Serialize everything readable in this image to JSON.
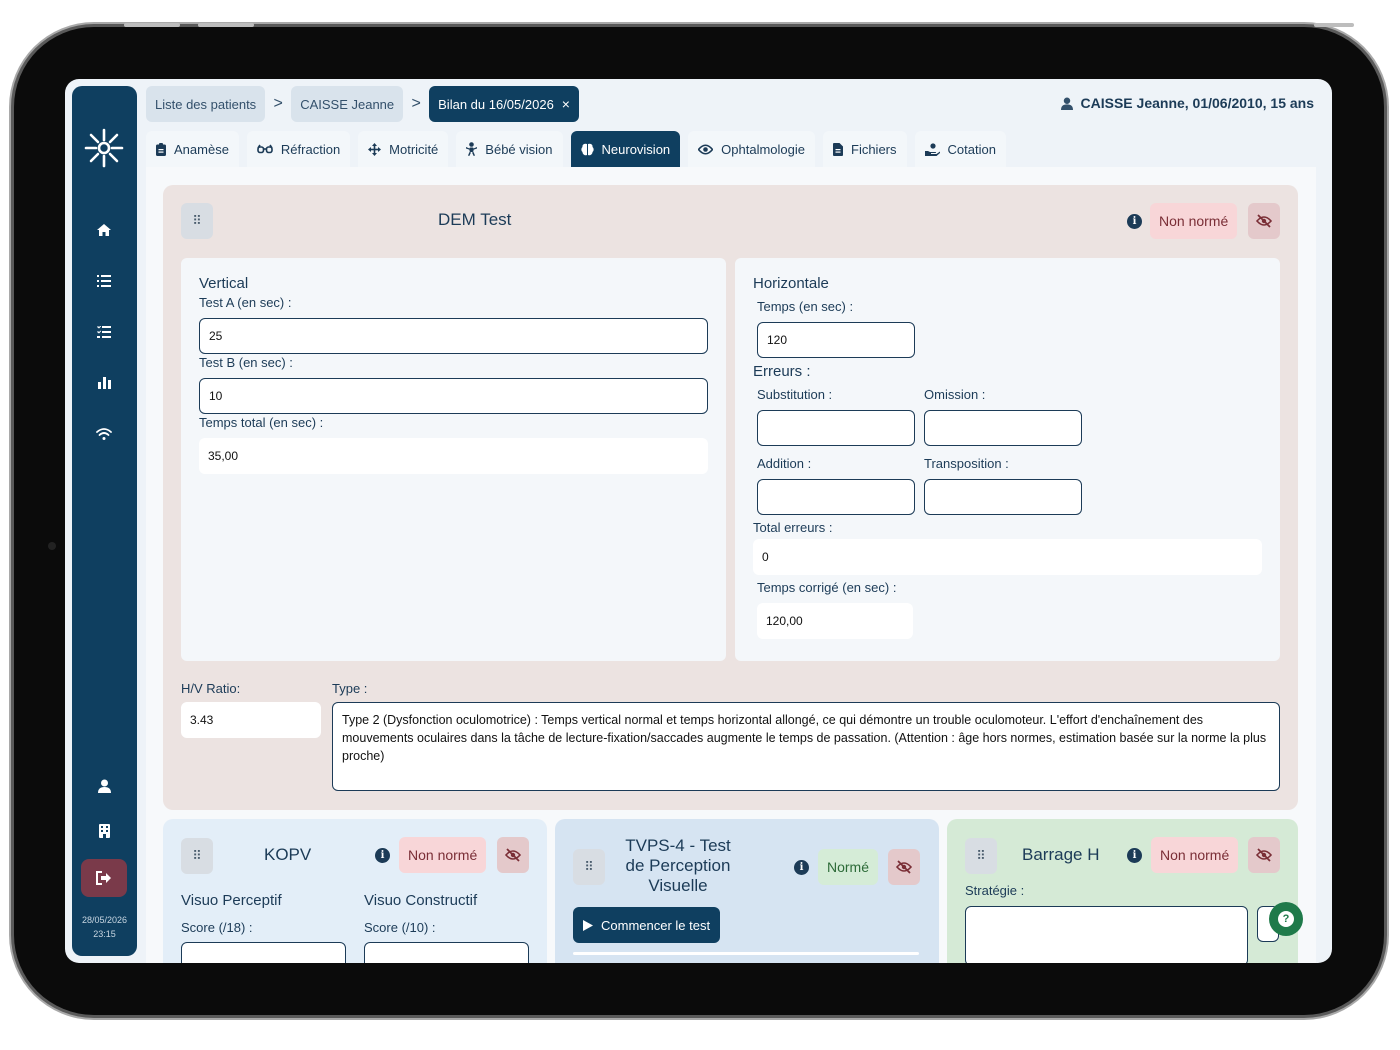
{
  "breadcrumb": {
    "items": [
      "Liste des patients",
      "CAISSE Jeanne",
      "Bilan du 16/05/2026"
    ],
    "close_icon": "×"
  },
  "user": {
    "label": "CAISSE Jeanne, 01/06/2010, 15 ans"
  },
  "tabs": [
    {
      "label": "Anamèse",
      "icon": "clipboard-icon"
    },
    {
      "label": "Réfraction",
      "icon": "glasses-icon"
    },
    {
      "label": "Motricité",
      "icon": "arrows-icon"
    },
    {
      "label": "Bébé vision",
      "icon": "baby-icon"
    },
    {
      "label": "Neurovision",
      "icon": "brain-icon",
      "active": true
    },
    {
      "label": "Ophtalmologie",
      "icon": "eye-icon"
    },
    {
      "label": "Fichiers",
      "icon": "file-icon"
    },
    {
      "label": "Cotation",
      "icon": "hand-coin-icon"
    }
  ],
  "sidebar": {
    "items": [
      "home-icon",
      "list-icon",
      "checklist-icon",
      "chart-icon",
      "wifi-icon",
      "user-icon",
      "building-icon"
    ],
    "date": "28/05/2026",
    "time": "23:15"
  },
  "dem": {
    "title": "DEM Test",
    "badge": "Non normé",
    "vertical": {
      "title": "Vertical",
      "test_a_label": "Test A (en sec) :",
      "test_a_value": "25",
      "test_b_label": "Test B (en sec) :",
      "test_b_value": "10",
      "total_label": "Temps total (en sec) :",
      "total_value": "35,00"
    },
    "horizontal": {
      "title": "Horizontale",
      "temps_label": "Temps (en sec) :",
      "temps_value": "120",
      "erreurs_label": "Erreurs :",
      "substitution_label": "Substitution :",
      "substitution_value": "",
      "omission_label": "Omission :",
      "omission_value": "",
      "addition_label": "Addition :",
      "addition_value": "",
      "transposition_label": "Transposition :",
      "transposition_value": "",
      "total_erreurs_label": "Total erreurs :",
      "total_erreurs_value": "0",
      "temps_corrige_label": "Temps corrigé (en sec) :",
      "temps_corrige_value": "120,00"
    },
    "ratio_label": "H/V Ratio:",
    "ratio_value": "3.43",
    "type_label": "Type :",
    "type_value": "Type 2 (Dysfonction oculomotrice) : Temps vertical normal et temps horizontal allongé, ce qui démontre un trouble oculomoteur. L'effort d'enchaînement des mouvements oculaires dans la tâche de lecture-fixation/saccades augmente le temps de passation. (Attention : âge hors normes, estimation basée sur la norme la plus proche)"
  },
  "kopv": {
    "title": "KOPV",
    "badge": "Non normé",
    "perceptif_label": "Visuo Perceptif",
    "constructif_label": "Visuo Constructif",
    "score_perceptif_label": "Score (/18) :",
    "score_constructif_label": "Score (/10) :"
  },
  "tvps": {
    "title_line1": "TVPS-4 - Test",
    "title_line2": "de Perception",
    "title_line3": "Visuelle",
    "badge": "Normé",
    "start_button": "Commencer le test"
  },
  "barrage": {
    "title": "Barrage H",
    "badge": "Non normé",
    "strategie_label": "Stratégie :"
  },
  "colors": {
    "navy": "#0f3f60",
    "dem_bg": "#ece3e1",
    "kopv_bg": "#e3eef8",
    "tvps_bg": "#d6e4f2",
    "barrage_bg": "#d5ead6",
    "non_norme_bg": "#f8d6d8",
    "norme_bg": "#d5ecd7"
  }
}
